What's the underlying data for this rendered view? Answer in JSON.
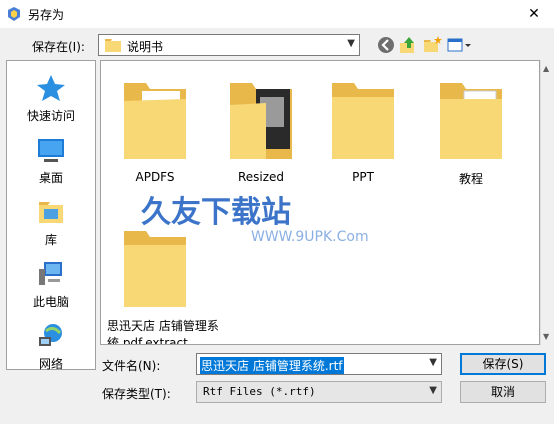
{
  "window": {
    "title": "另存为",
    "close": "✕"
  },
  "location": {
    "label": "保存在(I):",
    "value": "说明书"
  },
  "toolbar": {
    "back": "back-icon",
    "up": "up-folder-icon",
    "new_folder": "new-folder-icon",
    "view": "view-menu-icon"
  },
  "places": [
    {
      "label": "快速访问",
      "icon": "star-icon"
    },
    {
      "label": "桌面",
      "icon": "desktop-icon"
    },
    {
      "label": "库",
      "icon": "library-icon"
    },
    {
      "label": "此电脑",
      "icon": "computer-icon"
    },
    {
      "label": "网络",
      "icon": "network-icon"
    }
  ],
  "files": [
    {
      "name": "APDFS",
      "type": "folder"
    },
    {
      "name": "Resized",
      "type": "folder"
    },
    {
      "name": "PPT",
      "type": "folder"
    },
    {
      "name": "教程",
      "type": "folder"
    },
    {
      "name": "思迅天店 店铺管理系统.pdf.extract",
      "type": "folder"
    }
  ],
  "watermark": {
    "main": "久友下载站",
    "sub": "WWW.9UPK.Com"
  },
  "file_name": {
    "label": "文件名(N):",
    "value": "思迅天店 店铺管理系统.rtf"
  },
  "file_type": {
    "label": "保存类型(T):",
    "value": "Rtf Files (*.rtf)"
  },
  "buttons": {
    "save": "保存(S)",
    "cancel": "取消"
  },
  "colors": {
    "folder": "#f8d775",
    "folder_dark": "#e8b84a",
    "accent": "#0078d7"
  }
}
